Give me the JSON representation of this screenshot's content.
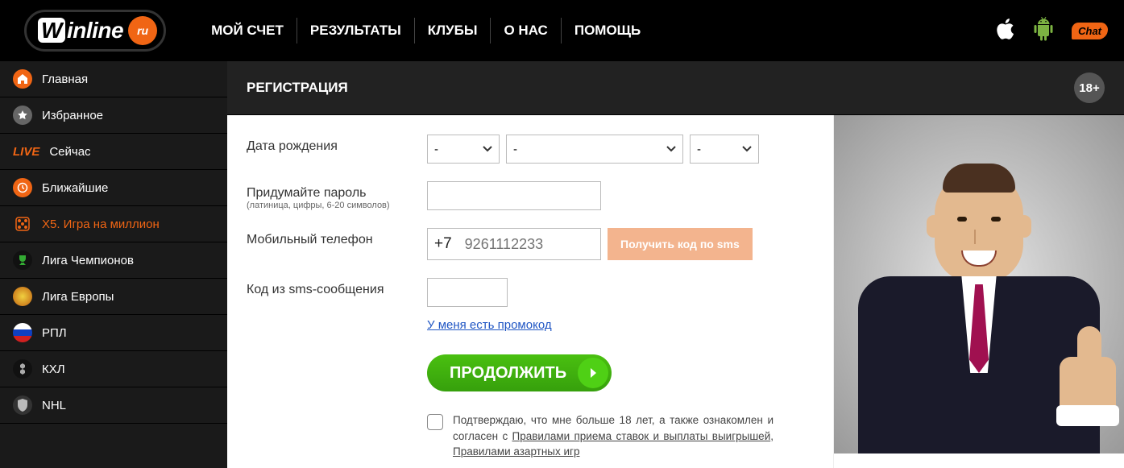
{
  "brand": {
    "name": "Winline",
    "tld": "ru"
  },
  "nav": {
    "items": [
      "МОЙ СЧЕТ",
      "РЕЗУЛЬТАТЫ",
      "КЛУБЫ",
      "О НАС",
      "ПОМОЩЬ"
    ]
  },
  "chat_label": "Chat",
  "age_badge": "18+",
  "sidebar": {
    "items": [
      {
        "label": "Главная"
      },
      {
        "label": "Избранное"
      },
      {
        "live_prefix": "LIVE",
        "label": "Сейчас"
      },
      {
        "label": "Ближайшие"
      },
      {
        "label": "X5. Игра на миллион",
        "active": true
      },
      {
        "label": "Лига Чемпионов"
      },
      {
        "label": "Лига Европы"
      },
      {
        "label": "РПЛ"
      },
      {
        "label": "КХЛ"
      },
      {
        "label": "NHL"
      }
    ]
  },
  "page": {
    "title": "РЕГИСТРАЦИЯ"
  },
  "form": {
    "dob_label": "Дата рождения",
    "dob_day": "-",
    "dob_month": "-",
    "dob_year": "-",
    "password_label": "Придумайте пароль",
    "password_hint": "(латиница, цифры, 6-20 символов)",
    "phone_label": "Мобильный телефон",
    "phone_prefix": "+7",
    "phone_placeholder": "9261112233",
    "sms_button": "Получить код по sms",
    "sms_code_label": "Код из sms-сообщения",
    "promo_link": "У меня есть промокод",
    "continue": "ПРОДОЛЖИТЬ",
    "terms_pre": "Подтверждаю, что мне больше 18 лет, а также ознакомлен и согласен с ",
    "terms_link1": "Правилами приема ставок и выплаты выигрышей",
    "terms_mid": ", ",
    "terms_link2": "Правилами азартных игр"
  }
}
